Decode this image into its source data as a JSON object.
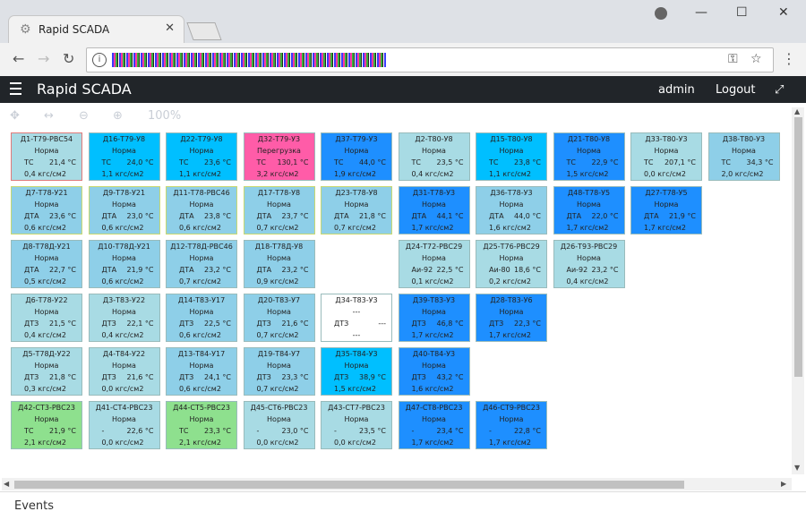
{
  "browser": {
    "tab_title": "Rapid SCADA",
    "tab_close": "✕",
    "win_minimize": "—",
    "win_maximize": "☐",
    "win_close": "✕"
  },
  "app": {
    "title": "Rapid SCADA",
    "user": "admin",
    "logout": "Logout"
  },
  "scheme_toolbar": {
    "zoom": "100%"
  },
  "colors": {
    "cyan": "#00bfff",
    "lightblue": "#8ecfe8",
    "pink": "#ff5ca8",
    "blue": "#1e8fff",
    "pale": "#a8dbe4",
    "green": "#8ee08e",
    "white": "#ffffff"
  },
  "grid": [
    [
      {
        "t": "Д1-Т79-РВС54",
        "s": "Норма",
        "a": "ТС",
        "b": "21,4 °С",
        "p": "0,4 кгс/см2",
        "c": "pale",
        "bc": "#e07a7a"
      },
      {
        "t": "Д16-Т79-У8",
        "s": "Норма",
        "a": "ТС",
        "b": "24,0 °С",
        "p": "1,1 кгс/см2",
        "c": "cyan"
      },
      {
        "t": "Д22-Т79-У8",
        "s": "Норма",
        "a": "ТС",
        "b": "23,6 °С",
        "p": "1,1 кгс/см2",
        "c": "cyan"
      },
      {
        "t": "Д32-Т79-У3",
        "s": "Перегрузка",
        "a": "ТС",
        "b": "130,1 °С",
        "p": "3,2 кгс/см2",
        "c": "pink"
      },
      {
        "t": "Д37-Т79-У3",
        "s": "Норма",
        "a": "ТС",
        "b": "44,0 °С",
        "p": "1,9 кгс/см2",
        "c": "blue"
      },
      {
        "t": "Д2-Т80-У8",
        "s": "Норма",
        "a": "ТС",
        "b": "23,5 °С",
        "p": "0,4 кгс/см2",
        "c": "pale"
      },
      {
        "t": "Д15-Т80-У8",
        "s": "Норма",
        "a": "ТС",
        "b": "23,8 °С",
        "p": "1,1 кгс/см2",
        "c": "cyan"
      },
      {
        "t": "Д21-Т80-У8",
        "s": "Норма",
        "a": "ТС",
        "b": "22,9 °С",
        "p": "1,5 кгс/см2",
        "c": "blue"
      },
      {
        "t": "Д33-Т80-У3",
        "s": "Норма",
        "a": "ТС",
        "b": "207,1 °С",
        "p": "0,0 кгс/см2",
        "c": "pale"
      },
      {
        "t": "Д38-Т80-У3",
        "s": "Норма",
        "a": "ТС",
        "b": "34,3 °С",
        "p": "2,0 кгс/см2",
        "c": "lightblue"
      }
    ],
    [
      {
        "t": "Д7-Т78-У21",
        "s": "Норма",
        "a": "ДТА",
        "b": "23,6 °С",
        "p": "0,6 кгс/см2",
        "c": "lightblue",
        "bc": "#c8d870"
      },
      {
        "t": "Д9-Т78-У21",
        "s": "Норма",
        "a": "ДТА",
        "b": "23,0 °С",
        "p": "0,6 кгс/см2",
        "c": "lightblue",
        "bc": "#c8d870"
      },
      {
        "t": "Д11-Т78-РВС46",
        "s": "Норма",
        "a": "ДТА",
        "b": "23,8 °С",
        "p": "0,6 кгс/см2",
        "c": "lightblue",
        "bc": "#c8d870"
      },
      {
        "t": "Д17-Т78-У8",
        "s": "Норма",
        "a": "ДТА",
        "b": "23,7 °С",
        "p": "0,7 кгс/см2",
        "c": "lightblue",
        "bc": "#c8d870"
      },
      {
        "t": "Д23-Т78-У8",
        "s": "Норма",
        "a": "ДТА",
        "b": "21,8 °С",
        "p": "0,7 кгс/см2",
        "c": "lightblue",
        "bc": "#c8d870"
      },
      {
        "t": "Д31-Т78-У3",
        "s": "Норма",
        "a": "ДТА",
        "b": "44,1 °С",
        "p": "1,7 кгс/см2",
        "c": "blue"
      },
      {
        "t": "Д36-Т78-У3",
        "s": "Норма",
        "a": "ДТА",
        "b": "44,0 °С",
        "p": "1,6 кгс/см2",
        "c": "lightblue"
      },
      {
        "t": "Д48-Т78-У5",
        "s": "Норма",
        "a": "ДТА",
        "b": "22,0 °С",
        "p": "1,7 кгс/см2",
        "c": "blue"
      },
      {
        "t": "Д27-Т78-У5",
        "s": "Норма",
        "a": "ДТА",
        "b": "21,9 °С",
        "p": "1,7 кгс/см2",
        "c": "blue"
      }
    ],
    [
      {
        "t": "Д8-Т78Д-У21",
        "s": "Норма",
        "a": "ДТА",
        "b": "22,7 °С",
        "p": "0,5 кгс/см2",
        "c": "lightblue"
      },
      {
        "t": "Д10-Т78Д-У21",
        "s": "Норма",
        "a": "ДТА",
        "b": "21,9 °С",
        "p": "0,6 кгс/см2",
        "c": "lightblue"
      },
      {
        "t": "Д12-Т78Д-РВС46",
        "s": "Норма",
        "a": "ДТА",
        "b": "23,2 °С",
        "p": "0,7 кгс/см2",
        "c": "lightblue"
      },
      {
        "t": "Д18-Т78Д-У8",
        "s": "Норма",
        "a": "ДТА",
        "b": "23,2 °С",
        "p": "0,9 кгс/см2",
        "c": "lightblue"
      },
      null,
      {
        "t": "Д24-Т72-РВС29",
        "s": "Норма",
        "a": "Аи-92",
        "b": "22,5 °С",
        "p": "0,1 кгс/см2",
        "c": "pale"
      },
      {
        "t": "Д25-Т76-РВС29",
        "s": "Норма",
        "a": "Аи-80",
        "b": "18,6 °С",
        "p": "0,2 кгс/см2",
        "c": "pale"
      },
      {
        "t": "Д26-Т93-РВС29",
        "s": "Норма",
        "a": "Аи-92",
        "b": "23,2 °С",
        "p": "0,4 кгс/см2",
        "c": "pale"
      }
    ],
    [
      {
        "t": "Д6-Т78-У22",
        "s": "Норма",
        "a": "ДТЗ",
        "b": "21,5 °С",
        "p": "0,4 кгс/см2",
        "c": "pale"
      },
      {
        "t": "Д3-Т83-У22",
        "s": "Норма",
        "a": "ДТЗ",
        "b": "22,1 °С",
        "p": "0,4 кгс/см2",
        "c": "pale"
      },
      {
        "t": "Д14-Т83-У17",
        "s": "Норма",
        "a": "ДТЗ",
        "b": "22,5 °С",
        "p": "0,6 кгс/см2",
        "c": "lightblue"
      },
      {
        "t": "Д20-Т83-У7",
        "s": "Норма",
        "a": "ДТЗ",
        "b": "21,6 °С",
        "p": "0,7 кгс/см2",
        "c": "lightblue"
      },
      {
        "t": "Д34-Т83-У3",
        "s": "---",
        "a": "ДТЗ",
        "b": "---",
        "p": "---",
        "c": "white",
        "pc": true
      },
      {
        "t": "Д39-Т83-У3",
        "s": "Норма",
        "a": "ДТЗ",
        "b": "46,8 °С",
        "p": "1,7 кгс/см2",
        "c": "blue"
      },
      {
        "t": "Д28-Т83-У6",
        "s": "Норма",
        "a": "ДТЗ",
        "b": "22,3 °С",
        "p": "1,7 кгс/см2",
        "c": "blue"
      }
    ],
    [
      {
        "t": "Д5-Т78Д-У22",
        "s": "Норма",
        "a": "ДТЗ",
        "b": "21,8 °С",
        "p": "0,3 кгс/см2",
        "c": "pale"
      },
      {
        "t": "Д4-Т84-У22",
        "s": "Норма",
        "a": "ДТЗ",
        "b": "21,6 °С",
        "p": "0,0 кгс/см2",
        "c": "pale"
      },
      {
        "t": "Д13-Т84-У17",
        "s": "Норма",
        "a": "ДТЗ",
        "b": "24,1 °С",
        "p": "0,6 кгс/см2",
        "c": "lightblue"
      },
      {
        "t": "Д19-Т84-У7",
        "s": "Норма",
        "a": "ДТЗ",
        "b": "23,3 °С",
        "p": "0,7 кгс/см2",
        "c": "lightblue"
      },
      {
        "t": "Д35-Т84-У3",
        "s": "Норма",
        "a": "ДТЗ",
        "b": "38,9 °С",
        "p": "1,5 кгс/см2",
        "c": "cyan"
      },
      {
        "t": "Д40-Т84-У3",
        "s": "Норма",
        "a": "ДТЗ",
        "b": "43,2 °С",
        "p": "1,6 кгс/см2",
        "c": "blue"
      }
    ],
    [
      {
        "t": "Д42-СТ3-РВС23",
        "s": "Норма",
        "a": "ТС",
        "b": "21,9 °С",
        "p": "2,1 кгс/см2",
        "c": "green"
      },
      {
        "t": "Д41-СТ4-РВС23",
        "s": "Норма",
        "a": "-",
        "b": "22,6 °С",
        "p": "0,0 кгс/см2",
        "c": "pale"
      },
      {
        "t": "Д44-СТ5-РВС23",
        "s": "Норма",
        "a": "ТС",
        "b": "23,3 °С",
        "p": "2,1 кгс/см2",
        "c": "green"
      },
      {
        "t": "Д45-СТ6-РВС23",
        "s": "Норма",
        "a": "-",
        "b": "23,0 °С",
        "p": "0,0 кгс/см2",
        "c": "pale"
      },
      {
        "t": "Д43-СТ7-РВС23",
        "s": "Норма",
        "a": "-",
        "b": "23,5 °С",
        "p": "0,0 кгс/см2",
        "c": "pale"
      },
      {
        "t": "Д47-СТ8-РВС23",
        "s": "Норма",
        "a": "-",
        "b": "23,4 °С",
        "p": "1,7 кгс/см2",
        "c": "blue"
      },
      {
        "t": "Д46-СТ9-РВС23",
        "s": "Норма",
        "a": "-",
        "b": "22,8 °С",
        "p": "1,7 кгс/см2",
        "c": "blue"
      }
    ]
  ],
  "events": {
    "label": "Events"
  }
}
